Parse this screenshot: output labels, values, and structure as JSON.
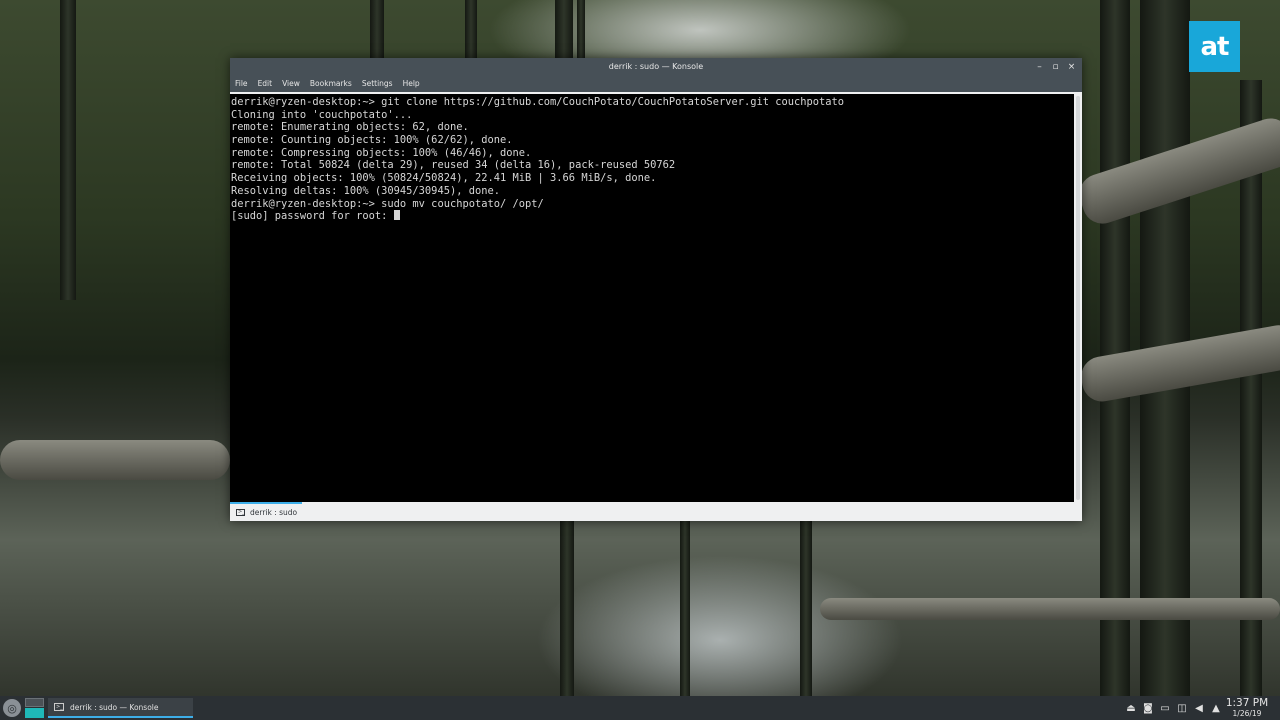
{
  "brand": {
    "logo_text": "at",
    "color": "#19a7d9"
  },
  "window": {
    "title": "derrik : sudo — Konsole",
    "controls": {
      "minimize": "–",
      "maximize": "▫",
      "close": "×"
    }
  },
  "menu": [
    "File",
    "Edit",
    "View",
    "Bookmarks",
    "Settings",
    "Help"
  ],
  "terminal": {
    "lines": [
      "derrik@ryzen-desktop:~> git clone https://github.com/CouchPotato/CouchPotatoServer.git couchpotato",
      "Cloning into 'couchpotato'...",
      "remote: Enumerating objects: 62, done.",
      "remote: Counting objects: 100% (62/62), done.",
      "remote: Compressing objects: 100% (46/46), done.",
      "remote: Total 50824 (delta 29), reused 34 (delta 16), pack-reused 50762",
      "Receiving objects: 100% (50824/50824), 22.41 MiB | 3.66 MiB/s, done.",
      "Resolving deltas: 100% (30945/30945), done.",
      "derrik@ryzen-desktop:~> sudo mv couchpotato/ /opt/"
    ],
    "prompt_line": "[sudo] password for root: "
  },
  "tab": {
    "label": "derrik : sudo",
    "icon": "terminal-icon"
  },
  "taskbar": {
    "task_label": "derrik : sudo — Konsole",
    "accent": "#3daee9",
    "pager_active": "#1fb8b8",
    "tray_icons": [
      "notification-icon",
      "camera-icon",
      "display-icon",
      "network-icon",
      "volume-icon",
      "expand-tray-icon"
    ],
    "clock": {
      "time": "1:37 PM",
      "date": "1/26/19"
    }
  }
}
